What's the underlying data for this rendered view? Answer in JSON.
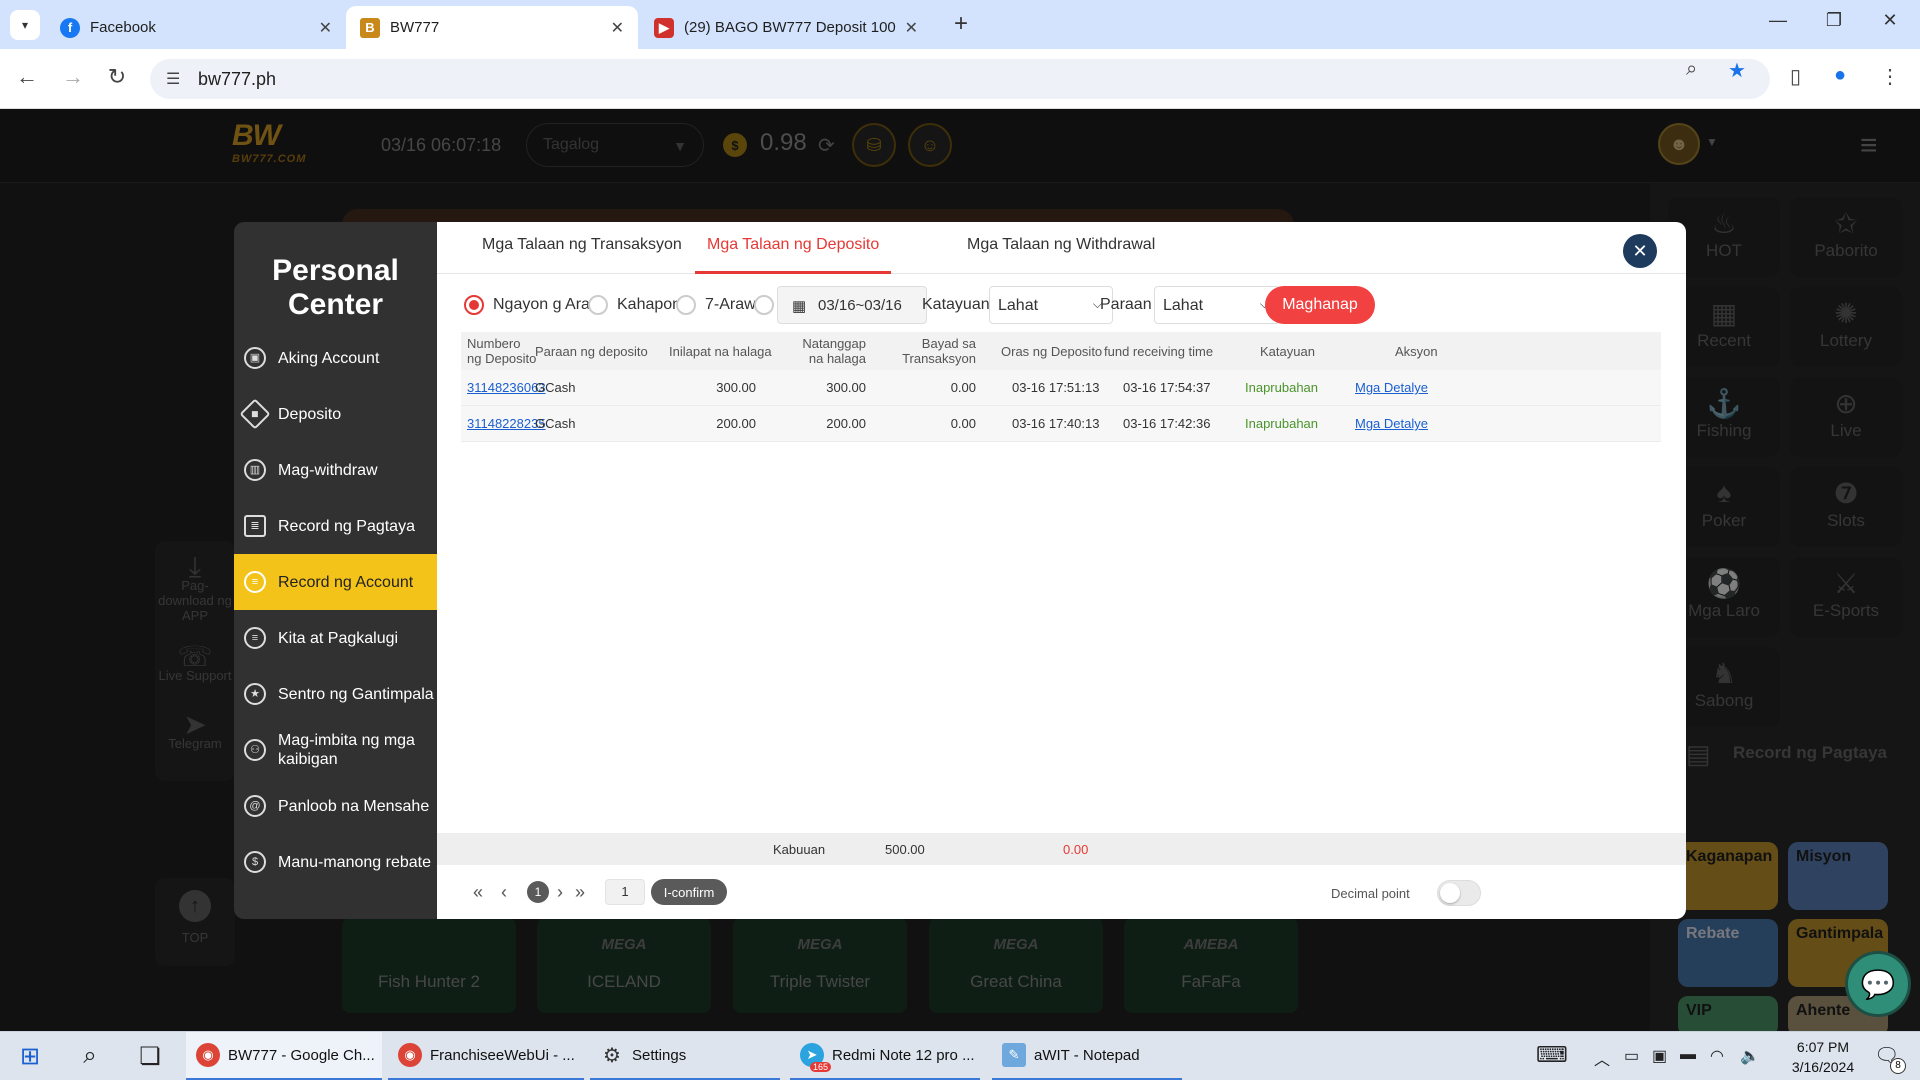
{
  "browser": {
    "tabs": [
      {
        "title": "Facebook",
        "icon": "facebook-icon"
      },
      {
        "title": "BW777",
        "icon": "bw777-icon"
      },
      {
        "title": "(29) BAGO BW777 Deposit 100",
        "icon": "youtube-icon"
      }
    ],
    "url": "bw777.ph"
  },
  "site": {
    "clock": "03/16 06:07:18",
    "language": "Tagalog",
    "balance": "0.98",
    "logo_text": "BW",
    "logo_sub": "BW777.COM",
    "left_float": [
      {
        "label": "Pag-download ng APP",
        "icon": "download-icon"
      },
      {
        "label": "Live Support",
        "icon": "headset-icon"
      },
      {
        "label": "Telegram",
        "icon": "telegram-icon"
      }
    ],
    "top_label": "TOP",
    "categories": [
      {
        "label": "HOT",
        "icon": "flame-icon"
      },
      {
        "label": "Paborito",
        "icon": "star-icon"
      },
      {
        "label": "Recent",
        "icon": "calendar-icon"
      },
      {
        "label": "Lottery",
        "icon": "lottery-icon"
      },
      {
        "label": "Fishing",
        "icon": "fish-icon"
      },
      {
        "label": "Live",
        "icon": "live-icon"
      },
      {
        "label": "Poker",
        "icon": "cards-icon"
      },
      {
        "label": "Slots",
        "icon": "slots-icon"
      },
      {
        "label": "Mga Laro",
        "icon": "ball-icon"
      },
      {
        "label": "E-Sports",
        "icon": "esports-icon"
      },
      {
        "label": "Sabong",
        "icon": "rooster-icon"
      }
    ],
    "right_record": "Record ng Pagtaya",
    "promos": [
      "Kaganapan",
      "Misyon",
      "Rebate",
      "Gantimpala",
      "VIP",
      "Ahente"
    ],
    "games": [
      {
        "brand": "",
        "name": "Fish Hunter 2"
      },
      {
        "brand": "MEGA",
        "name": "ICELAND"
      },
      {
        "brand": "MEGA",
        "name": "Triple Twister"
      },
      {
        "brand": "MEGA",
        "name": "Great China"
      },
      {
        "brand": "AMEBA",
        "name": "FaFaFa"
      }
    ]
  },
  "sidebar": {
    "title": "Personal Center",
    "items": [
      {
        "label": "Aking Account",
        "icon": "account-icon"
      },
      {
        "label": "Deposito",
        "icon": "deposit-icon"
      },
      {
        "label": "Mag-withdraw",
        "icon": "withdraw-icon"
      },
      {
        "label": "Record ng Pagtaya",
        "icon": "bet-record-icon"
      },
      {
        "label": "Record ng Account",
        "icon": "account-record-icon"
      },
      {
        "label": "Kita at Pagkalugi",
        "icon": "profit-loss-icon"
      },
      {
        "label": "Sentro ng Gantimpala",
        "icon": "reward-icon"
      },
      {
        "label": "Mag-imbita ng mga kaibigan",
        "icon": "invite-icon"
      },
      {
        "label": "Panloob na Mensahe",
        "icon": "message-icon"
      },
      {
        "label": "Manu-manong rebate",
        "icon": "rebate-icon"
      }
    ]
  },
  "panel": {
    "tabs": [
      "Mga Talaan ng Transaksyon",
      "Mga Talaan ng Deposito",
      "Mga Talaan ng Withdrawal"
    ],
    "active_tab": 1,
    "filters": {
      "ranges": [
        "Ngayon g Araw",
        "Kahapon",
        "7-Araw"
      ],
      "selected_range": 0,
      "date_range": "03/16~03/16",
      "status_label": "Katayuan :",
      "status_value": "Lahat",
      "method_label": "Paraan :",
      "method_value": "Lahat",
      "search_label": "Maghanap"
    },
    "columns": [
      "Numbero ng Deposito",
      "Paraan ng deposito",
      "Inilapat na halaga",
      "Natanggap na halaga",
      "Bayad sa Transaksyon",
      "Oras ng Deposito",
      "fund receiving time",
      "Katayuan",
      "Aksyon"
    ],
    "rows": [
      {
        "id": "31148236063",
        "method": "GCash",
        "applied": "300.00",
        "received": "300.00",
        "fee": "0.00",
        "deposit_time": "03-16 17:51:13",
        "receive_time": "03-16 17:54:37",
        "status": "Inaprubahan",
        "action": "Mga Detalye"
      },
      {
        "id": "31148228235",
        "method": "GCash",
        "applied": "200.00",
        "received": "200.00",
        "fee": "0.00",
        "deposit_time": "03-16 17:40:13",
        "receive_time": "03-16 17:42:36",
        "status": "Inaprubahan",
        "action": "Mga Detalye"
      }
    ],
    "summary": {
      "label": "Kabuuan",
      "received": "500.00",
      "fee": "0.00"
    },
    "pager": {
      "current": "1",
      "goto": "1",
      "confirm": "I-confirm",
      "decimal_label": "Decimal point"
    }
  },
  "taskbar": {
    "apps": [
      {
        "label": "BW777 - Google Ch...",
        "icon": "chrome-icon"
      },
      {
        "label": "FranchiseeWebUi - ...",
        "icon": "chrome-icon"
      },
      {
        "label": "Settings",
        "icon": "gear-icon"
      },
      {
        "label": "Redmi Note 12 pro ...",
        "icon": "telegram-icon",
        "badge": "165"
      },
      {
        "label": "aWIT - Notepad",
        "icon": "notepad-icon"
      }
    ],
    "time": "6:07 PM",
    "date": "3/16/2024",
    "notifications": "8"
  },
  "colors": {
    "accent": "#f24141",
    "sidebar_active": "#f4c319",
    "approved": "#49952b",
    "link": "#1a5fd0"
  }
}
